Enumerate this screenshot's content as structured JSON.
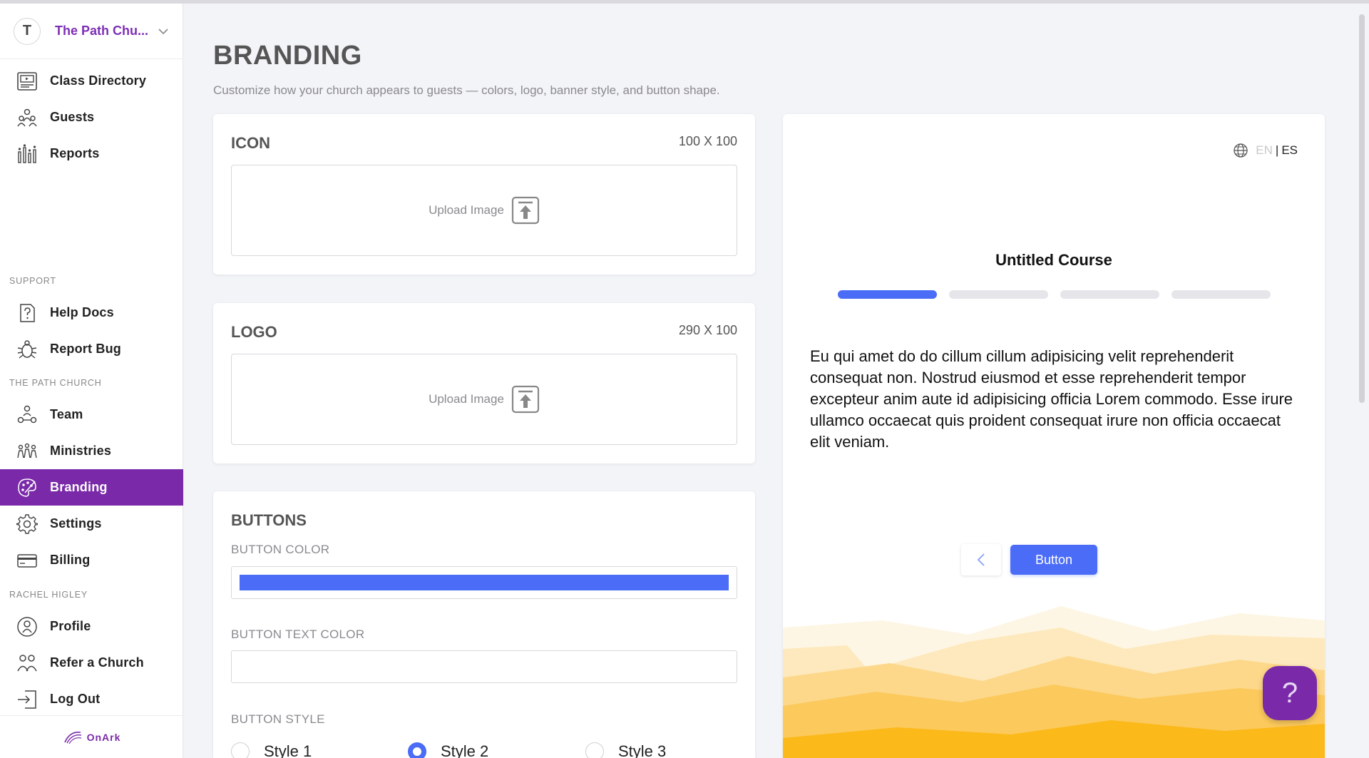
{
  "sidebar": {
    "org": {
      "initial": "T",
      "name": "The Path Chu..."
    },
    "items_top": [
      {
        "label": "Class Directory",
        "icon": "class-directory-icon"
      },
      {
        "label": "Guests",
        "icon": "guests-icon"
      },
      {
        "label": "Reports",
        "icon": "reports-icon"
      }
    ],
    "support_label": "SUPPORT",
    "support_items": [
      {
        "label": "Help Docs",
        "icon": "help-docs-icon"
      },
      {
        "label": "Report Bug",
        "icon": "bug-icon"
      }
    ],
    "church_label": "THE PATH CHURCH",
    "church_items": [
      {
        "label": "Team",
        "icon": "team-icon"
      },
      {
        "label": "Ministries",
        "icon": "ministries-icon"
      },
      {
        "label": "Branding",
        "icon": "palette-icon",
        "active": true
      },
      {
        "label": "Settings",
        "icon": "gear-icon"
      },
      {
        "label": "Billing",
        "icon": "credit-card-icon"
      }
    ],
    "user_label": "RACHEL HIGLEY",
    "user_items": [
      {
        "label": "Profile",
        "icon": "profile-icon"
      },
      {
        "label": "Refer a Church",
        "icon": "refer-icon"
      },
      {
        "label": "Log Out",
        "icon": "logout-icon"
      }
    ],
    "brand": "OnArk"
  },
  "main": {
    "title": "BRANDING",
    "subtitle": "Customize how your church appears to guests — colors, logo, banner style, and button shape.",
    "icon_card": {
      "title": "ICON",
      "dimensions": "100 X 100",
      "upload_label": "Upload Image"
    },
    "logo_card": {
      "title": "LOGO",
      "dimensions": "290 X 100",
      "upload_label": "Upload Image"
    },
    "buttons_card": {
      "title": "BUTTONS",
      "color_label": "BUTTON COLOR",
      "color_value": "#4a6cf7",
      "text_color_label": "BUTTON TEXT COLOR",
      "text_color_value": "#ffffff",
      "style_label": "BUTTON STYLE",
      "styles": [
        "Style 1",
        "Style 2",
        "Style 3"
      ],
      "selected_style": "Style 2"
    }
  },
  "preview": {
    "lang_en": "EN",
    "lang_sep": "|",
    "lang_es": "ES",
    "course_title": "Untitled Course",
    "progress_steps": 4,
    "progress_current": 1,
    "body": "Eu qui amet do do cillum cillum adipisicing velit reprehenderit consequat non. Nostrud eiusmod et esse reprehenderit tempor excepteur anim aute id adipisicing officia Lorem commodo. Esse irure ullamco occaecat quis proident consequat irure non officia occaecat elit veniam.",
    "button_label": "Button"
  },
  "help_fab": "?",
  "colors": {
    "accent": "#7a2aa8",
    "button": "#4a6cf7",
    "hill_colors": [
      "#fef6e4",
      "#fde9bd",
      "#fdd88a",
      "#fcc95c",
      "#fbb91a"
    ]
  }
}
